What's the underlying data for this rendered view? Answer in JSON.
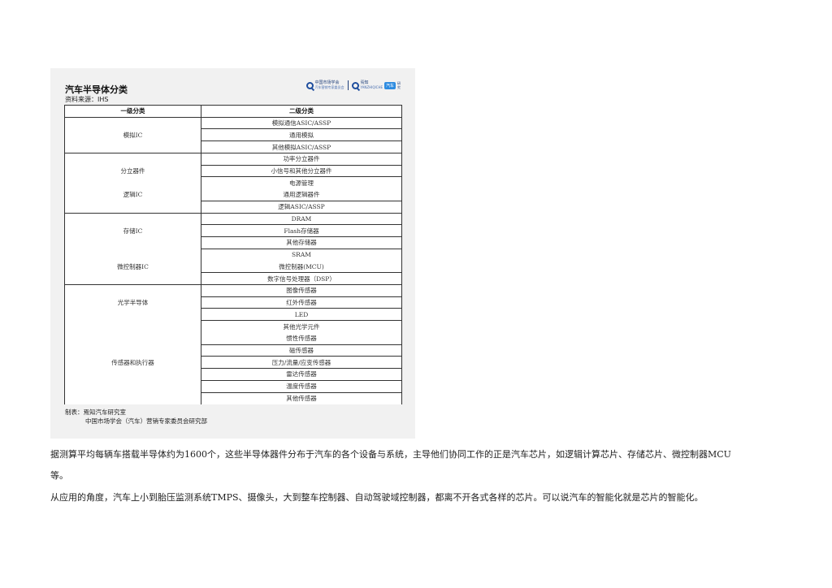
{
  "figure": {
    "title": "汽车半导体分类",
    "source": "资料来源：IHS",
    "logos": {
      "org_name": "中国市场学会",
      "org_sub": "汽车营销专家委员会",
      "brand_name": "焉知",
      "brand_sub": "YANZHIQICHE",
      "badge": "汽车",
      "tail": "研究"
    },
    "table": {
      "headers": [
        "一级分类",
        "二级分类"
      ],
      "rows": [
        {
          "l1": "",
          "l2": "模拟通信ASIC/ASSP"
        },
        {
          "l1": "模拟IC",
          "l2": "通用模拟"
        },
        {
          "l1": "",
          "l2": "其他模拟ASIC/ASSP"
        },
        {
          "l1": "",
          "l2": "功率分立器件"
        },
        {
          "l1": "分立器件",
          "l2": "小信号和其他分立器件"
        },
        {
          "l1": "",
          "l2": "电源管理"
        },
        {
          "l1": "逻辑IC",
          "l2": "通用逻辑器件"
        },
        {
          "l1": "",
          "l2": "逻辑ASIC/ASSP"
        },
        {
          "l1": "",
          "l2": "DRAM"
        },
        {
          "l1": "存储IC",
          "l2": "Flash存储器"
        },
        {
          "l1": "",
          "l2": "其他存储器"
        },
        {
          "l1": "",
          "l2": "SRAM"
        },
        {
          "l1": "微控制器IC",
          "l2": "微控制器(MCU)"
        },
        {
          "l1": "",
          "l2": "数字信号处理器（DSP）"
        },
        {
          "l1": "",
          "l2": "图像传感器"
        },
        {
          "l1": "光学半导体",
          "l2": "红外传感器"
        },
        {
          "l1": "",
          "l2": "LED"
        },
        {
          "l1": "",
          "l2": "其他光学元件"
        },
        {
          "l1": "",
          "l2": "惯性传感器"
        },
        {
          "l1": "",
          "l2": "磁传感器"
        },
        {
          "l1": "传感器和执行器",
          "l2": "压力/流量/应变传感器"
        },
        {
          "l1": "",
          "l2": "雷达传感器"
        },
        {
          "l1": "",
          "l2": "温度传感器"
        },
        {
          "l1": "",
          "l2": "其他传感器"
        }
      ]
    },
    "footer": {
      "line1": "制表：焉知汽车研究室",
      "line2": "中国市场学会（汽车）营销专家委员会研究部"
    }
  },
  "paragraphs": {
    "p1a": "据测算平均每辆车搭载半导体约为1600个，这些半导体器件分布于汽车的各个设备与系统，主导他们协同工作的正是汽车芯片，如逻辑计算芯片、存储芯片、微控制器MCU",
    "p1b": "等。",
    "p2": "从应用的角度，汽车上小到胎压监测系统TMPS、摄像头，大到整车控制器、自动驾驶域控制器，都离不开各式各样的芯片。可以说汽车的智能化就是芯片的智能化。"
  }
}
